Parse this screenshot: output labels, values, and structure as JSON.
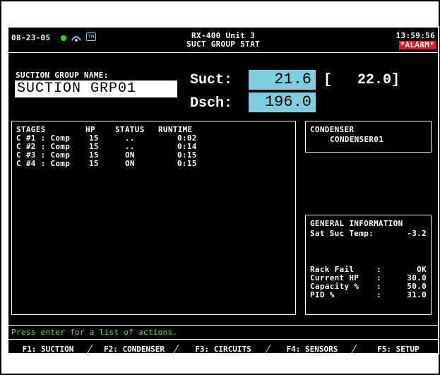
{
  "header": {
    "date": "08-23-05",
    "unit": "RX-400 Unit 3",
    "screen_title": "SUCT GROUP STAT",
    "time": "13:59:56",
    "alarm": "*ALARM*"
  },
  "suction_group": {
    "label": "SUCTION GROUP NAME:",
    "name": "SUCTION GRP01"
  },
  "pressures": {
    "suct_label": "Suct:",
    "suct_value": "21.6",
    "setpoint": "[   22.0]",
    "dsch_label": "Dsch:",
    "dsch_value": "196.0"
  },
  "stages": {
    "headers": [
      "STAGES",
      "HP",
      "STATUS",
      "RUNTIME"
    ],
    "rows": [
      {
        "stage": "C #1 : Comp",
        "hp": "15",
        "status": "..",
        "runtime": "0:02"
      },
      {
        "stage": "C #2 : Comp",
        "hp": "15",
        "status": "..",
        "runtime": "0:14"
      },
      {
        "stage": "C #3 : Comp",
        "hp": "15",
        "status": "ON",
        "runtime": "0:15"
      },
      {
        "stage": "C #4 : Comp",
        "hp": "15",
        "status": "ON",
        "runtime": "0:15"
      }
    ]
  },
  "condenser": {
    "title": "CONDENSER",
    "name": "CONDENSER01"
  },
  "general_info": {
    "title": "GENERAL INFORMATION",
    "sat_suc_label": "Sat Suc Temp:",
    "sat_suc_value": "-3.2",
    "rows": [
      {
        "label": "Rack Fail",
        "value": "OK"
      },
      {
        "label": "Current HP",
        "value": "30.0"
      },
      {
        "label": "Capacity %",
        "value": "50.0"
      },
      {
        "label": "PID %",
        "value": "31.0"
      }
    ]
  },
  "status_line": "Press enter for a list of actions.",
  "function_keys": [
    {
      "label": "F1: SUCTION"
    },
    {
      "label": "F2: CONDENSER"
    },
    {
      "label": "F3: CIRCUITS"
    },
    {
      "label": "F4: SENSORS"
    },
    {
      "label": "F5: SETUP"
    }
  ],
  "colors": {
    "value_box": "#7ed0e0",
    "alarm_bg": "#e8141e",
    "status_text": "#7cdc32",
    "status_dot": "#2bd02b"
  }
}
